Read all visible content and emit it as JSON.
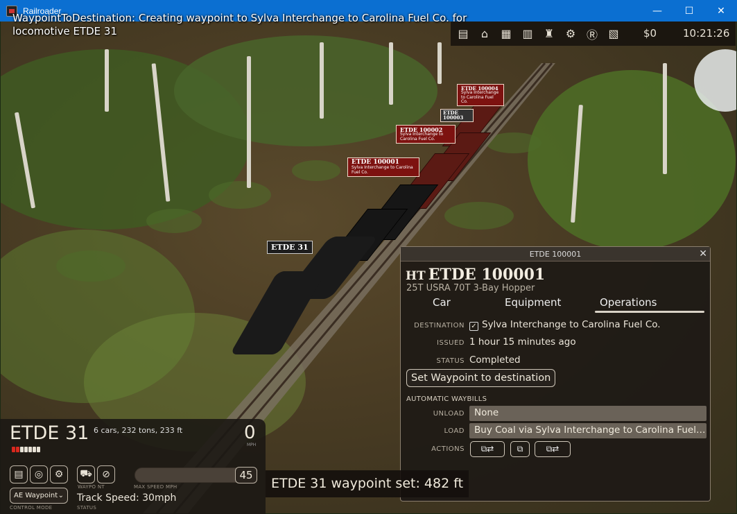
{
  "window": {
    "title": "Railroader",
    "minimize_glyph": "—",
    "maximize_glyph": "☐",
    "close_glyph": "✕"
  },
  "notice": {
    "text": "WaypointToDestination: Creating waypoint to Sylva Interchange to Carolina Fuel Co. for locomotive ETDE 31"
  },
  "topbar": {
    "icons": [
      "timetable-icon",
      "station-icon",
      "switchlist-icon",
      "industry-icon",
      "company-icon",
      "settings-icon",
      "railroader-logo-icon",
      "orders-icon"
    ],
    "money": "$0",
    "time": "10:21:26"
  },
  "world": {
    "car_tags": [
      {
        "id": "ETDE 100001",
        "sub": "Sylva Interchange to Carolina Fuel Co."
      },
      {
        "id": "ETDE 100002",
        "sub": "Sylva Interchange to Carolina Fuel Co."
      },
      {
        "id": "ETDE 100003",
        "sub": ""
      },
      {
        "id": "ETDE 100004",
        "sub": "Sylva Interchange to Carolina Fuel Co."
      }
    ],
    "loco_tag": "ETDE 31"
  },
  "panel": {
    "header": "ETDE 100001",
    "reporting_mark": "HT",
    "car_id": "ETDE 100001",
    "car_type": "25T USRA 70T 3-Bay Hopper",
    "tabs": [
      "Car",
      "Equipment",
      "Operations"
    ],
    "active_tab": "Operations",
    "destination_label": "DESTINATION",
    "destination_value": "Sylva Interchange to Carolina Fuel Co.",
    "issued_label": "ISSUED",
    "issued_value": "1 hour 15 minutes ago",
    "status_label": "STATUS",
    "status_value": "Completed",
    "waypoint_button": "Set Waypoint to destination",
    "auto_waybills_title": "AUTOMATIC WAYBILLS",
    "unload_label": "UNLOAD",
    "unload_value": "None",
    "load_label": "LOAD",
    "load_value": "Buy Coal via Sylva Interchange to Carolina Fuel Co.",
    "actions_label": "ACTIONS"
  },
  "loco_hud": {
    "name": "ETDE 31",
    "stats": "6 cars, 232 tons, 233 ft",
    "speed": "0",
    "speed_unit": "MPH",
    "max_speed": "45",
    "max_speed_label": "MAX SPEED MPH",
    "waypoint_label": "WAYPO NT",
    "control_mode": "AE Waypoint",
    "control_mode_label": "CONTROL MODE",
    "track_speed": "Track Speed: 30mph",
    "status_label": "STATUS",
    "indicator_colors": [
      "#d9281e",
      "#d9281e",
      "#e8e2d6",
      "#e8e2d6",
      "#e8e2d6",
      "#e8e2d6",
      "#e8e2d6"
    ]
  },
  "toast": {
    "text": "ETDE 31 waypoint set: 482 ft"
  },
  "colors": {
    "titlebar": "#0b6fd1",
    "tag_red": "#7d1210",
    "panel_bg": "#1e1a16"
  }
}
